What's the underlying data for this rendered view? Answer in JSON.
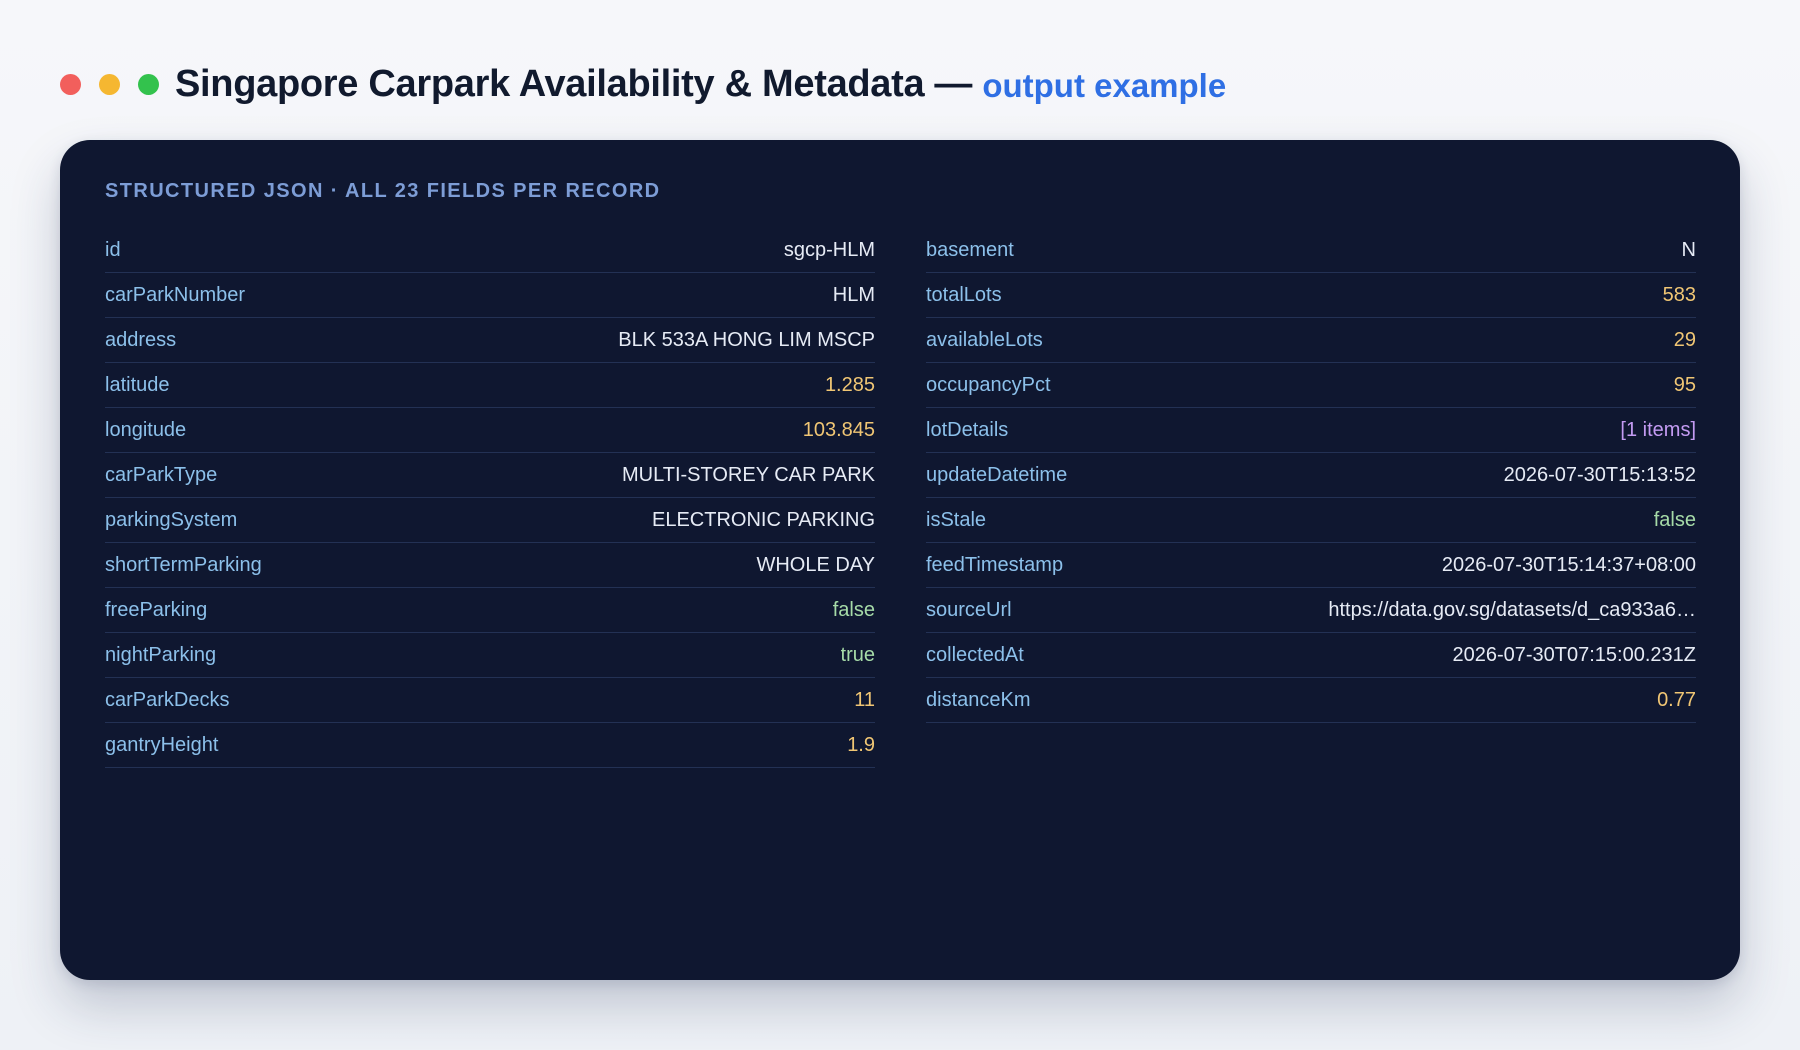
{
  "header": {
    "title": "Singapore Carpark Availability & Metadata",
    "separator": "—",
    "subtitle": "output example",
    "window_dots": [
      {
        "name": "close",
        "color": "#f25f5c"
      },
      {
        "name": "minimize",
        "color": "#f5b731"
      },
      {
        "name": "maximize",
        "color": "#33c24d"
      }
    ]
  },
  "panel": {
    "label": "STRUCTURED JSON · ALL 23 FIELDS PER RECORD",
    "left_fields": [
      {
        "key": "id",
        "value": "sgcp-HLM",
        "type": "string"
      },
      {
        "key": "carParkNumber",
        "value": "HLM",
        "type": "string"
      },
      {
        "key": "address",
        "value": "BLK 533A HONG LIM MSCP",
        "type": "string"
      },
      {
        "key": "latitude",
        "value": "1.285",
        "type": "number"
      },
      {
        "key": "longitude",
        "value": "103.845",
        "type": "number"
      },
      {
        "key": "carParkType",
        "value": "MULTI-STOREY CAR PARK",
        "type": "string"
      },
      {
        "key": "parkingSystem",
        "value": "ELECTRONIC PARKING",
        "type": "string"
      },
      {
        "key": "shortTermParking",
        "value": "WHOLE DAY",
        "type": "string"
      },
      {
        "key": "freeParking",
        "value": "false",
        "type": "bool"
      },
      {
        "key": "nightParking",
        "value": "true",
        "type": "bool"
      },
      {
        "key": "carParkDecks",
        "value": "11",
        "type": "number"
      },
      {
        "key": "gantryHeight",
        "value": "1.9",
        "type": "number"
      }
    ],
    "right_fields": [
      {
        "key": "basement",
        "value": "N",
        "type": "string"
      },
      {
        "key": "totalLots",
        "value": "583",
        "type": "number"
      },
      {
        "key": "availableLots",
        "value": "29",
        "type": "number"
      },
      {
        "key": "occupancyPct",
        "value": "95",
        "type": "number"
      },
      {
        "key": "lotDetails",
        "value": "[1 items]",
        "type": "array"
      },
      {
        "key": "updateDatetime",
        "value": "2026-07-30T15:13:52",
        "type": "string"
      },
      {
        "key": "isStale",
        "value": "false",
        "type": "bool"
      },
      {
        "key": "feedTimestamp",
        "value": "2026-07-30T15:14:37+08:00",
        "type": "string"
      },
      {
        "key": "sourceUrl",
        "value": "https://data.gov.sg/datasets/d_ca933a6…",
        "type": "string"
      },
      {
        "key": "collectedAt",
        "value": "2026-07-30T07:15:00.231Z",
        "type": "string"
      },
      {
        "key": "distanceKm",
        "value": "0.77",
        "type": "number"
      }
    ],
    "type_colors": {
      "string": "#e6ebf5",
      "number": "#f0c674",
      "bool": "#a6dba8",
      "array": "#c39bf2",
      "key": "#8cc0ea"
    }
  }
}
